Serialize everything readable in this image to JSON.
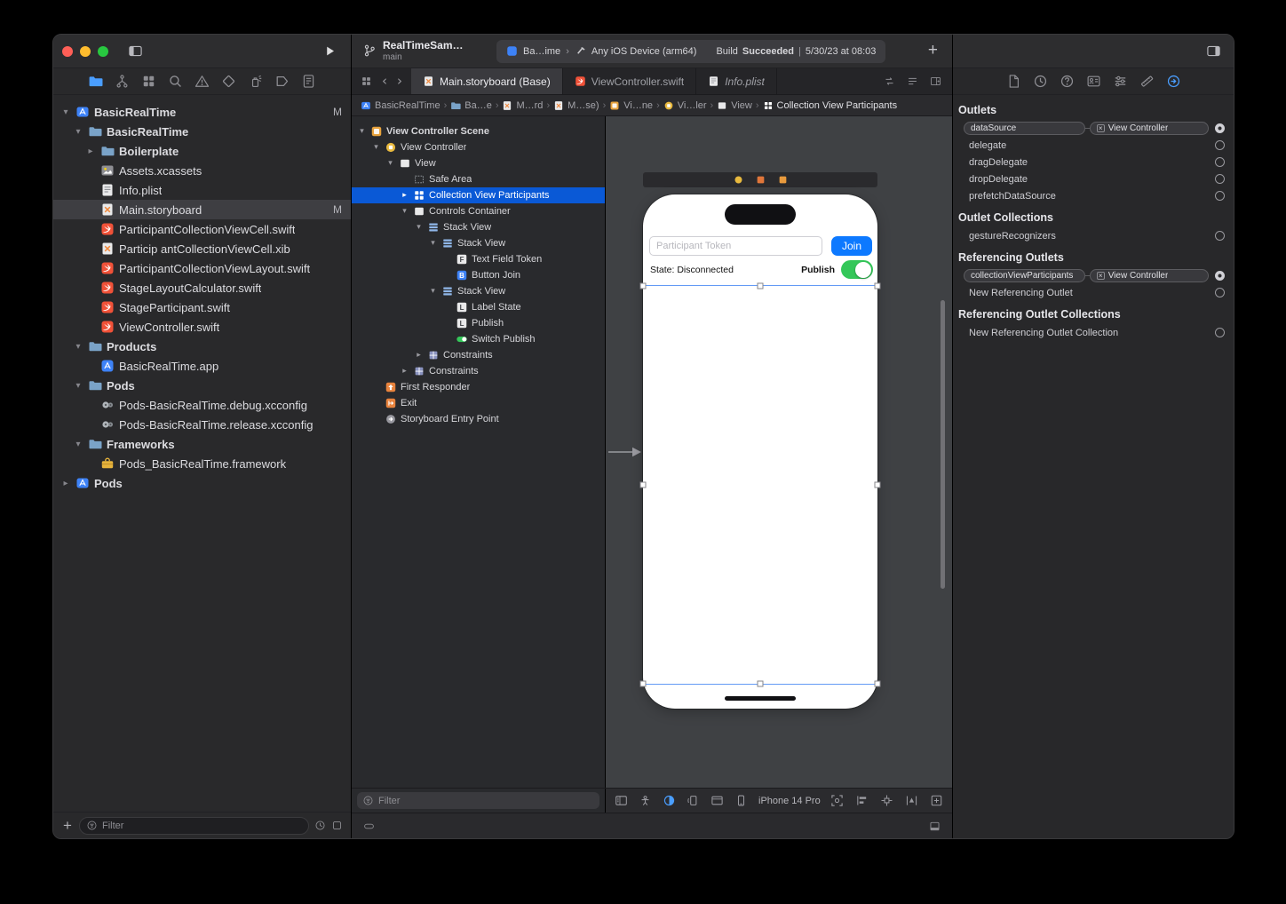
{
  "colors": {
    "accent_blue": "#3d82f7",
    "selection_blue": "#0a59d6",
    "switch_green": "#34c759",
    "swift_orange": "#f05138",
    "storyboard_orange": "#f0883b",
    "scene_yellow": "#e8b93e"
  },
  "titlebar": {
    "project": "RealTimeSam…",
    "branch": "main",
    "status": {
      "app": "Ba…ime",
      "chevron": "›",
      "destination": "Any iOS Device (arm64)",
      "build_prefix": "Build",
      "build_status": "Succeeded",
      "separator": "|",
      "time": "5/30/23 at 08:03"
    }
  },
  "navigator": {
    "tab_icons": [
      "project-navigator",
      "source-control-navigator",
      "symbol-navigator",
      "find-navigator",
      "issue-navigator",
      "test-navigator",
      "debug-navigator",
      "breakpoint-navigator",
      "report-navigator"
    ],
    "active_tab": 0,
    "filter_placeholder": "Filter",
    "items": [
      {
        "label": "BasicRealTime",
        "level": 0,
        "icon": "project",
        "chevron": "down",
        "badge": "M",
        "bold": true
      },
      {
        "label": "BasicRealTime",
        "level": 1,
        "icon": "folder",
        "chevron": "down",
        "bold": true
      },
      {
        "label": "Boilerplate",
        "level": 2,
        "icon": "folder",
        "chevron": "right",
        "bold": true
      },
      {
        "label": "Assets.xcassets",
        "level": 2,
        "icon": "assets"
      },
      {
        "label": "Info.plist",
        "level": 2,
        "icon": "plist"
      },
      {
        "label": "Main.storyboard",
        "level": 2,
        "icon": "storyboard",
        "badge": "M",
        "selected": true
      },
      {
        "label": "ParticipantCollectionViewCell.swift",
        "level": 2,
        "icon": "swift"
      },
      {
        "label": "Particip antCollectionViewCell.xib",
        "level": 2,
        "icon": "storyboard"
      },
      {
        "label": "ParticipantCollectionViewLayout.swift",
        "level": 2,
        "icon": "swift"
      },
      {
        "label": "StageLayoutCalculator.swift",
        "level": 2,
        "icon": "swift"
      },
      {
        "label": "StageParticipant.swift",
        "level": 2,
        "icon": "swift"
      },
      {
        "label": "ViewController.swift",
        "level": 2,
        "icon": "swift"
      },
      {
        "label": "Products",
        "level": 1,
        "icon": "folder",
        "chevron": "down",
        "bold": true
      },
      {
        "label": "BasicRealTime.app",
        "level": 2,
        "icon": "app"
      },
      {
        "label": "Pods",
        "level": 1,
        "icon": "folder",
        "chevron": "down",
        "bold": true
      },
      {
        "label": "Pods-BasicRealTime.debug.xcconfig",
        "level": 2,
        "icon": "xcconfig"
      },
      {
        "label": "Pods-BasicRealTime.release.xcconfig",
        "level": 2,
        "icon": "xcconfig"
      },
      {
        "label": "Frameworks",
        "level": 1,
        "icon": "folder",
        "chevron": "down",
        "bold": true
      },
      {
        "label": "Pods_BasicRealTime.framework",
        "level": 2,
        "icon": "framework"
      },
      {
        "label": "Pods",
        "level": 0,
        "icon": "project",
        "chevron": "right",
        "bold": true
      }
    ]
  },
  "editor": {
    "tabs": [
      {
        "label": "Main.storyboard (Base)",
        "icon": "storyboard",
        "active": true,
        "italic": false
      },
      {
        "label": "ViewController.swift",
        "icon": "swift",
        "active": false,
        "italic": false
      },
      {
        "label": "Info.plist",
        "icon": "plist",
        "active": false,
        "italic": true
      }
    ],
    "jumpbar": [
      {
        "label": "BasicRealTime",
        "icon": "project"
      },
      {
        "label": "Ba…e",
        "icon": "folder"
      },
      {
        "label": "M…rd",
        "icon": "storyboard"
      },
      {
        "label": "M…se)",
        "icon": "storyboard"
      },
      {
        "label": "Vi…ne",
        "icon": "scene"
      },
      {
        "label": "Vi…ler",
        "icon": "viewcontroller"
      },
      {
        "label": "View",
        "icon": "view"
      },
      {
        "label": "Collection View Participants",
        "icon": "collection"
      }
    ]
  },
  "outline": {
    "filter_placeholder": "Filter",
    "items": [
      {
        "label": "View Controller Scene",
        "level": 0,
        "icon": "scene",
        "chevron": "down",
        "bold": true
      },
      {
        "label": "View Controller",
        "level": 1,
        "icon": "viewcontroller",
        "chevron": "down"
      },
      {
        "label": "View",
        "level": 2,
        "icon": "view",
        "chevron": "down"
      },
      {
        "label": "Safe Area",
        "level": 3,
        "icon": "safearea"
      },
      {
        "label": "Collection View Participants",
        "level": 3,
        "icon": "collection",
        "chevron": "right",
        "selected": true
      },
      {
        "label": "Controls Container",
        "level": 3,
        "icon": "view",
        "chevron": "down"
      },
      {
        "label": "Stack View",
        "level": 4,
        "icon": "stack",
        "chevron": "down"
      },
      {
        "label": "Stack View",
        "level": 5,
        "icon": "stack",
        "chevron": "down"
      },
      {
        "label": "Text Field Token",
        "level": 6,
        "icon": "textfield"
      },
      {
        "label": "Button Join",
        "level": 6,
        "icon": "button"
      },
      {
        "label": "Stack View",
        "level": 5,
        "icon": "stack",
        "chevron": "down"
      },
      {
        "label": "Label State",
        "level": 6,
        "icon": "label"
      },
      {
        "label": "Publish",
        "level": 6,
        "icon": "label"
      },
      {
        "label": "Switch Publish",
        "level": 6,
        "icon": "switch"
      },
      {
        "label": "Constraints",
        "level": 4,
        "icon": "constraints",
        "chevron": "right"
      },
      {
        "label": "Constraints",
        "level": 3,
        "icon": "constraints",
        "chevron": "right"
      },
      {
        "label": "First Responder",
        "level": 1,
        "icon": "firstresponder"
      },
      {
        "label": "Exit",
        "level": 1,
        "icon": "exit"
      },
      {
        "label": "Storyboard Entry Point",
        "level": 1,
        "icon": "entrypoint"
      }
    ]
  },
  "canvas": {
    "device": {
      "token_placeholder": "Participant Token",
      "join": "Join",
      "state": "State: Disconnected",
      "publish": "Publish"
    },
    "scene_dock_icons": [
      "dock-viewcontroller",
      "dock-firstresponder",
      "dock-exit"
    ],
    "bottom_bar": {
      "left_icons": [
        "outline-toggle",
        "accessibility",
        "appearance",
        "orientation",
        "adjust-editor",
        "device"
      ],
      "device_name": "iPhone 14 Pro",
      "right_icons": [
        "zoom-to-fit",
        "align",
        "add-constraints",
        "resolve-layout",
        "embed"
      ]
    }
  },
  "inspector": {
    "tab_icons": [
      "file-inspector",
      "history-inspector",
      "quick-help-inspector",
      "identity-inspector",
      "attributes-inspector",
      "size-inspector",
      "connections-inspector"
    ],
    "active_tab": 6,
    "sections": [
      {
        "title": "Outlets",
        "rows": [
          {
            "name": "dataSource",
            "connected": true,
            "target": "View Controller"
          },
          {
            "name": "delegate",
            "connected": false
          },
          {
            "name": "dragDelegate",
            "connected": false
          },
          {
            "name": "dropDelegate",
            "connected": false
          },
          {
            "name": "prefetchDataSource",
            "connected": false
          }
        ]
      },
      {
        "title": "Outlet Collections",
        "rows": [
          {
            "name": "gestureRecognizers",
            "connected": false
          }
        ]
      },
      {
        "title": "Referencing Outlets",
        "rows": [
          {
            "name": "collectionViewParticipants",
            "connected": true,
            "target": "View Controller"
          },
          {
            "name": "New Referencing Outlet",
            "connected": false
          }
        ]
      },
      {
        "title": "Referencing Outlet Collections",
        "rows": [
          {
            "name": "New Referencing Outlet Collection",
            "connected": false
          }
        ]
      }
    ]
  }
}
